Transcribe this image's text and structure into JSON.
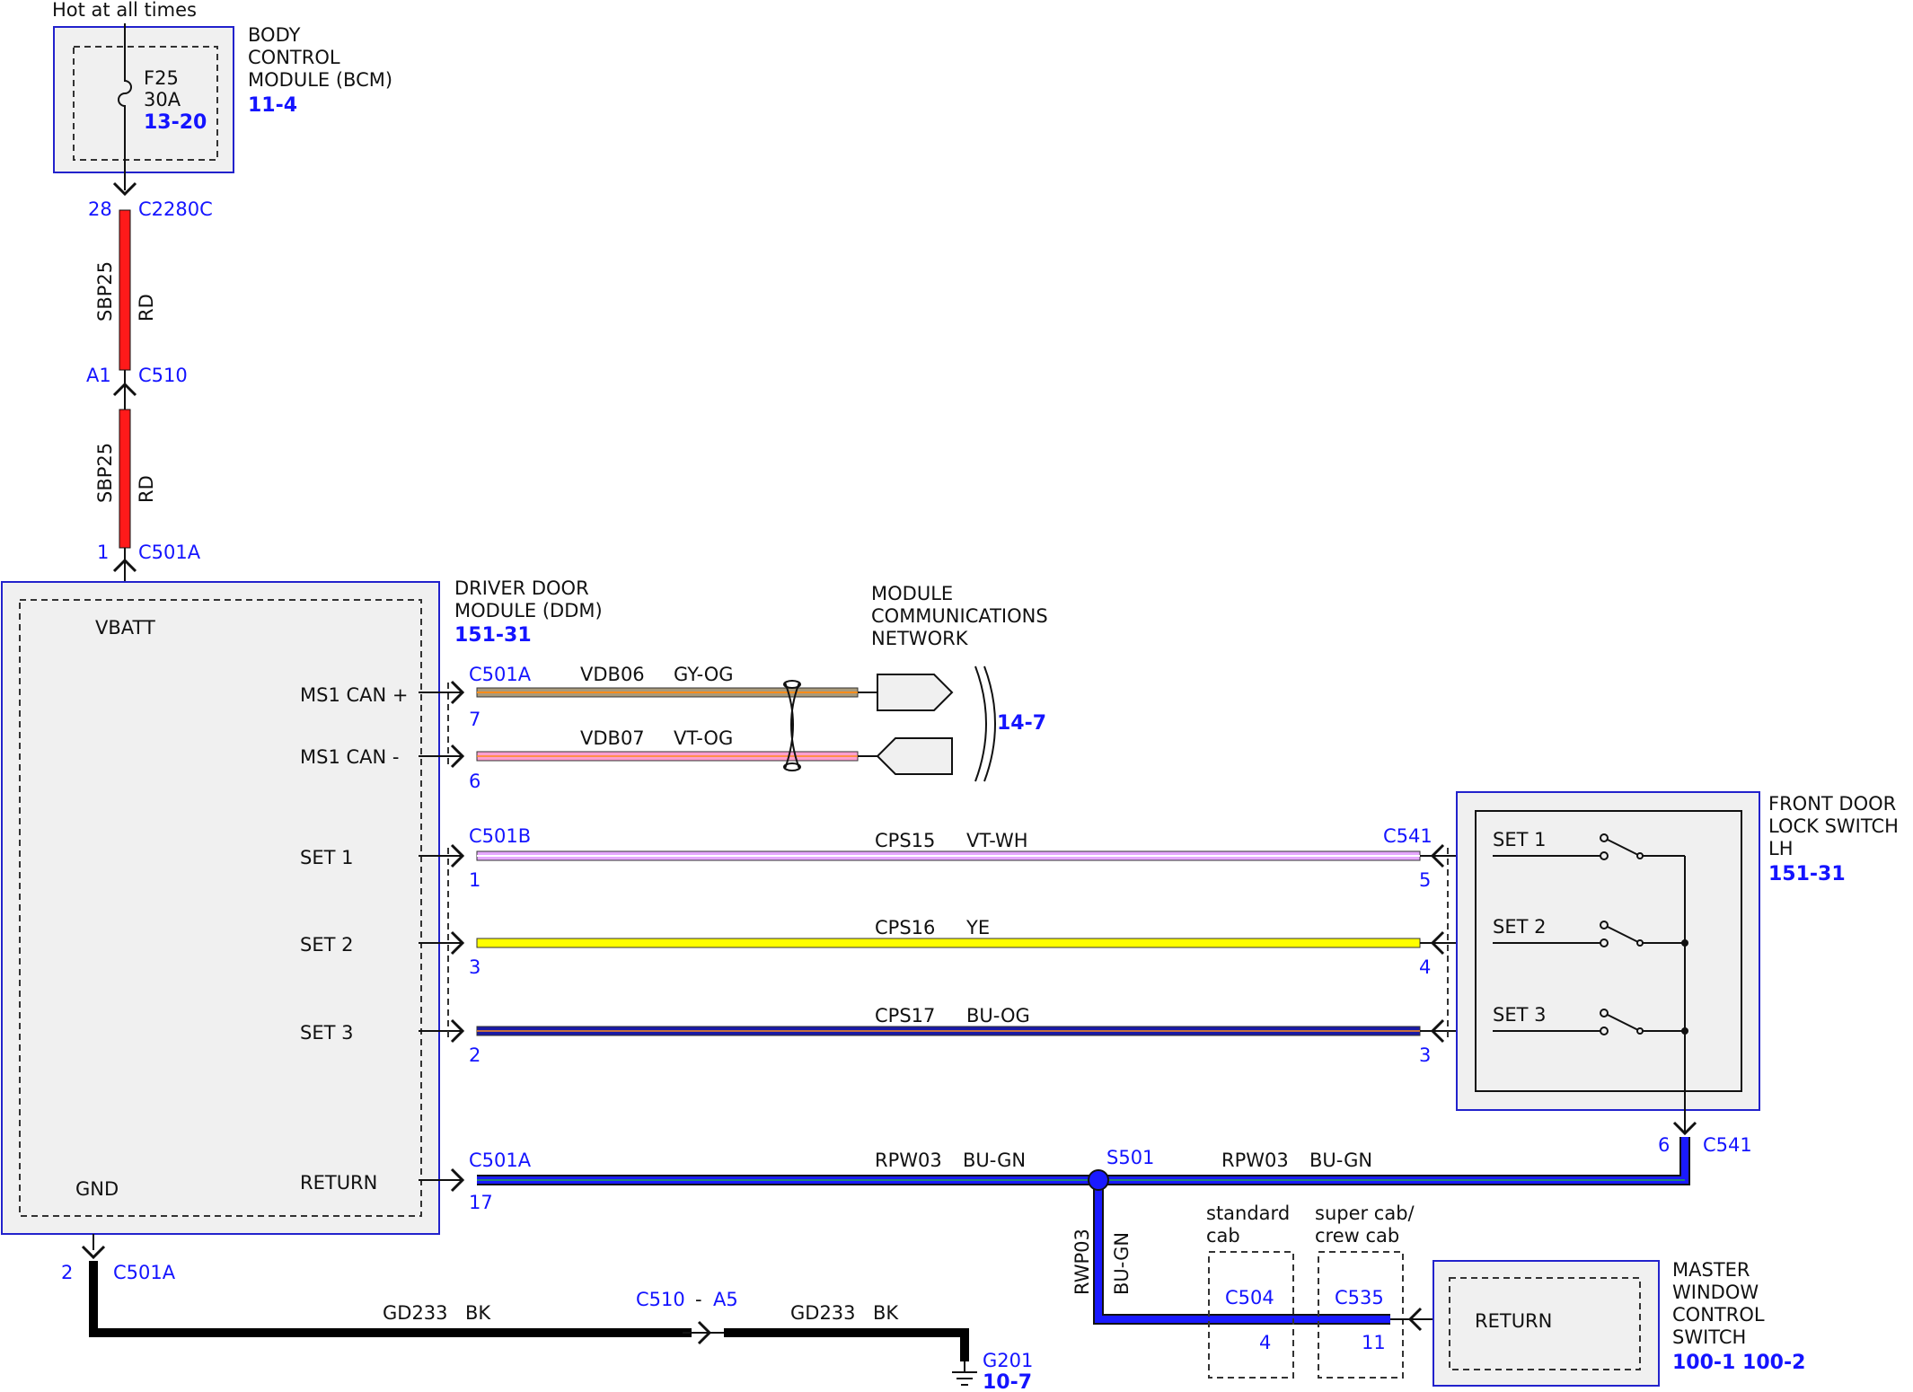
{
  "power_label": "Hot at all times",
  "bcm": {
    "name_lines": [
      "BODY",
      "CONTROL",
      "MODULE (BCM)"
    ],
    "ref": "11-4",
    "fuse_id": "F25",
    "fuse_rating": "30A",
    "fuse_ref": "13-20"
  },
  "connectors": {
    "bcm_out": {
      "pin": "28",
      "name": "C2280C"
    },
    "c510": {
      "pin": "A1",
      "name": "C510"
    },
    "ddm_in": {
      "pin": "1",
      "name": "C501A"
    },
    "can_plus": {
      "name": "C501A",
      "pin": "7"
    },
    "can_minus": {
      "pin": "6"
    },
    "set1_ddm": {
      "name": "C501B",
      "pin": "1"
    },
    "set2_ddm": {
      "pin": "3"
    },
    "set3_ddm": {
      "pin": "2"
    },
    "return_ddm": {
      "name": "C501A",
      "pin": "17"
    },
    "gnd_ddm": {
      "pin": "2",
      "name": "C501A"
    },
    "gnd_inline": {
      "name": "C510",
      "sep": "-",
      "pin": "A5"
    },
    "set1_sw": {
      "name": "C541",
      "pin": "5"
    },
    "set2_sw": {
      "pin": "4"
    },
    "set3_sw": {
      "pin": "3"
    },
    "sw_out": {
      "pin": "6",
      "name": "C541"
    },
    "c504": {
      "name": "C504",
      "pin": "4"
    },
    "c535": {
      "name": "C535",
      "pin": "11"
    }
  },
  "wires": {
    "sbp25_upper": {
      "circuit": "SBP25",
      "color": "RD"
    },
    "sbp25_lower": {
      "circuit": "SBP25",
      "color": "RD"
    },
    "can_plus": {
      "circuit": "VDB06",
      "color": "GY-OG"
    },
    "can_minus": {
      "circuit": "VDB07",
      "color": "VT-OG"
    },
    "set1": {
      "circuit": "CPS15",
      "color": "VT-WH"
    },
    "set2": {
      "circuit": "CPS16",
      "color": "YE"
    },
    "set3": {
      "circuit": "CPS17",
      "color": "BU-OG"
    },
    "return_left": {
      "circuit": "RPW03",
      "color": "BU-GN"
    },
    "return_right": {
      "circuit": "RPW03",
      "color": "BU-GN"
    },
    "return_down": {
      "circuit": "RWP03",
      "color": "BU-GN"
    },
    "gnd_left": {
      "circuit": "GD233",
      "color": "BK"
    },
    "gnd_right": {
      "circuit": "GD233",
      "color": "BK"
    }
  },
  "ddm": {
    "name_lines": [
      "DRIVER DOOR",
      "MODULE (DDM)"
    ],
    "ref": "151-31",
    "pins": {
      "vbatt": "VBATT",
      "can_plus": "MS1 CAN +",
      "can_minus": "MS1 CAN -",
      "set1": "SET 1",
      "set2": "SET 2",
      "set3": "SET 3",
      "return": "RETURN",
      "gnd": "GND"
    }
  },
  "network": {
    "name_lines": [
      "MODULE",
      "COMMUNICATIONS",
      "NETWORK"
    ],
    "ref": "14-7"
  },
  "lock_switch": {
    "name_lines": [
      "FRONT DOOR",
      "LOCK SWITCH",
      "LH"
    ],
    "ref": "151-31",
    "pins": {
      "set1": "SET 1",
      "set2": "SET 2",
      "set3": "SET 3"
    }
  },
  "splice": {
    "name": "S501"
  },
  "cab_variants": {
    "standard": [
      "standard",
      "cab"
    ],
    "super": [
      "super cab/",
      "crew cab"
    ]
  },
  "master_switch": {
    "name_lines": [
      "MASTER",
      "WINDOW",
      "CONTROL",
      "SWITCH"
    ],
    "ref": "100-1 100-2",
    "pin": "RETURN"
  },
  "ground": {
    "name": "G201",
    "ref": "10-7"
  },
  "colors": {
    "ref_blue": "#1414ff",
    "module_border": "#2222cc",
    "module_fill": "#f0f0f0",
    "red_wire": "#ff1a1a",
    "blue_wire": "#1a1aff",
    "yellow_wire": "#ffff00",
    "pink_wire": "#ff9fd0",
    "violet_wire": "#e6a8ff",
    "navy_wire": "#1a1aa6",
    "gray_orange_wire": "#a89a7a"
  }
}
